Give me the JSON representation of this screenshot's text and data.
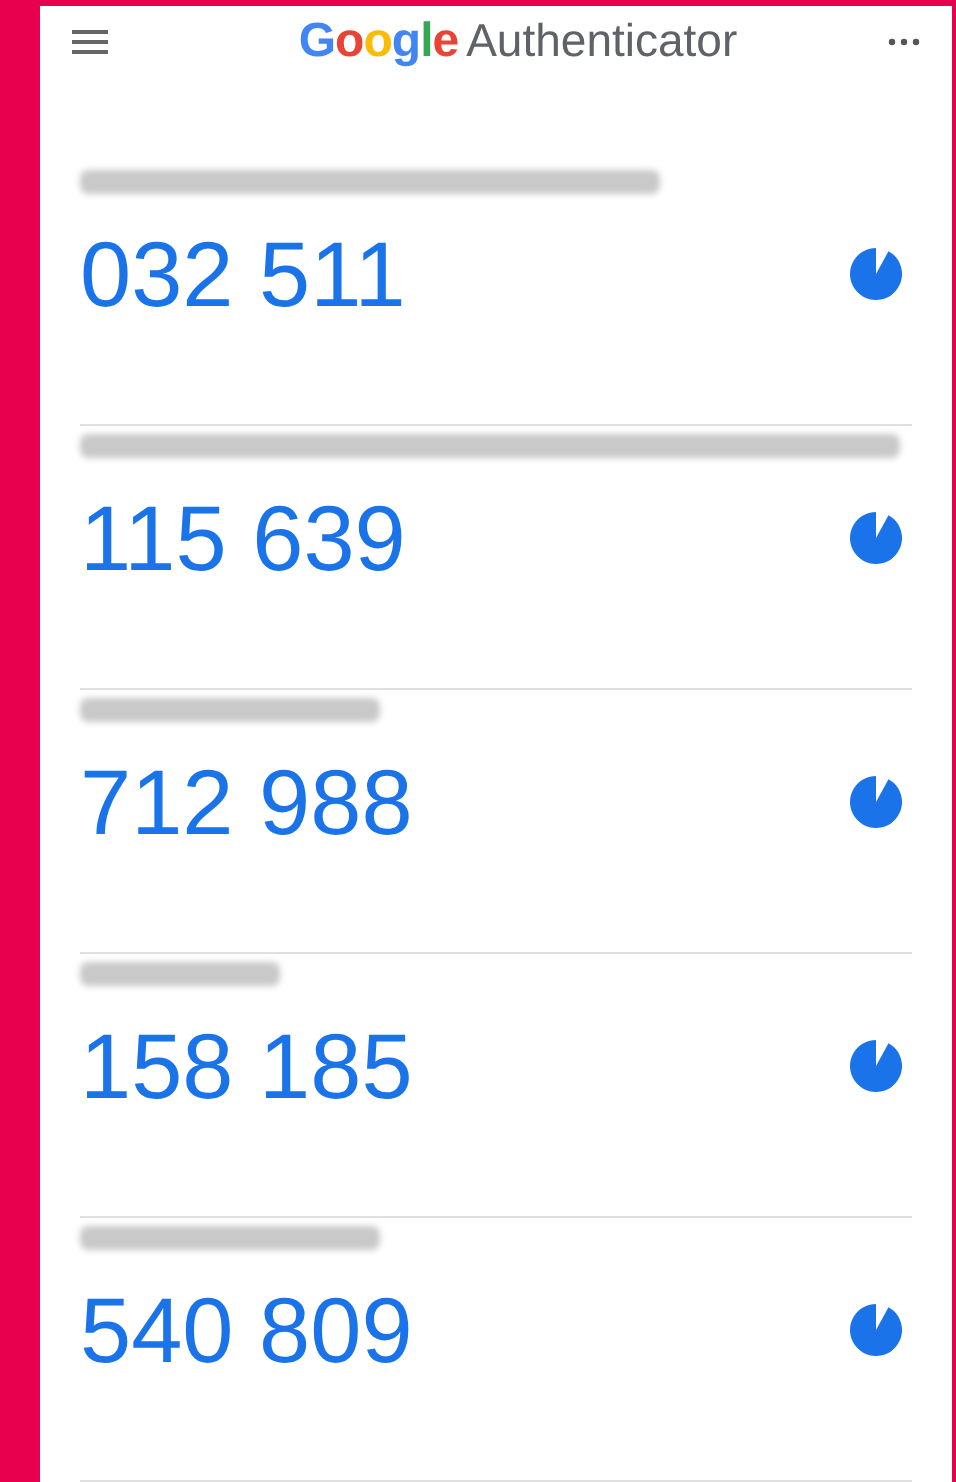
{
  "app_bar": {
    "brand": "Google",
    "title": "Authenticator"
  },
  "accounts": [
    {
      "code": "032 511",
      "level": 0.92
    },
    {
      "code": "115 639",
      "level": 0.92
    },
    {
      "code": "712 988",
      "level": 0.92
    },
    {
      "code": "158 185",
      "level": 0.92
    },
    {
      "code": "540 809",
      "level": 0.92
    }
  ]
}
